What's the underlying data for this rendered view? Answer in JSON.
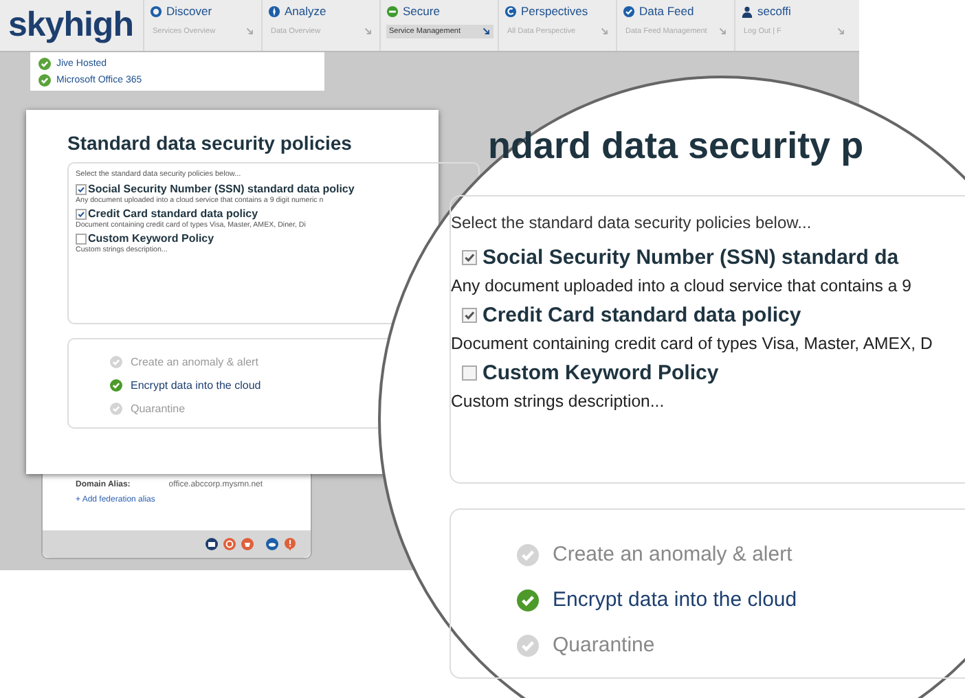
{
  "logo": "skyhigh",
  "nav": [
    {
      "title": "Discover",
      "subtitle": "Services Overview",
      "selected": false
    },
    {
      "title": "Analyze",
      "subtitle": "Data Overview",
      "selected": false
    },
    {
      "title": "Secure",
      "subtitle": "Service Management",
      "selected": true
    },
    {
      "title": "Perspectives",
      "subtitle": "All Data Perspective",
      "selected": false
    },
    {
      "title": "Data Feed",
      "subtitle": "Data Feed Management",
      "selected": false
    },
    {
      "title": "secoffi",
      "subtitle": "Log Out | F",
      "selected": false
    }
  ],
  "services": [
    {
      "name": "Jive Hosted",
      "checked": true
    },
    {
      "name": "Microsoft Office 365",
      "checked": true
    }
  ],
  "dialog": {
    "title": "Standard data security policies",
    "intro": "Select the standard data security policies below...",
    "policies": [
      {
        "name": "Social Security Number (SSN) standard data policy",
        "checked": true,
        "description": "Any document uploaded into a cloud service that contains a 9 digit numeric n"
      },
      {
        "name": "Credit Card standard data policy",
        "checked": true,
        "description": "Document containing credit card of types Visa, Master, AMEX, Diner, Di"
      },
      {
        "name": "Custom Keyword Policy",
        "checked": false,
        "description": "Custom strings description..."
      }
    ],
    "actions": [
      {
        "label": "Create an anomaly & alert",
        "selected": false
      },
      {
        "label": "Encrypt data into the cloud",
        "selected": true
      },
      {
        "label": "Quarantine",
        "selected": false
      }
    ]
  },
  "card": {
    "label": "Domain Alias:",
    "value": "office.abccorp.mysmn.net",
    "link": "+ Add federation alias"
  },
  "magnifier": {
    "title": "ndard data security p",
    "intro": "Select the standard data security policies below...",
    "policies": [
      {
        "name": "Social Security Number (SSN) standard da",
        "checked": true,
        "description": "Any document uploaded into a cloud service that contains a 9"
      },
      {
        "name": "Credit Card standard data policy",
        "checked": true,
        "description": "Document containing credit card of types Visa, Master, AMEX, D"
      },
      {
        "name": "Custom Keyword Policy",
        "checked": false,
        "description": "Custom strings description..."
      }
    ],
    "actions": [
      {
        "label": "Create an anomaly & alert",
        "selected": false
      },
      {
        "label": "Encrypt data into the cloud",
        "selected": true
      },
      {
        "label": "Quarantine",
        "selected": false
      }
    ]
  }
}
